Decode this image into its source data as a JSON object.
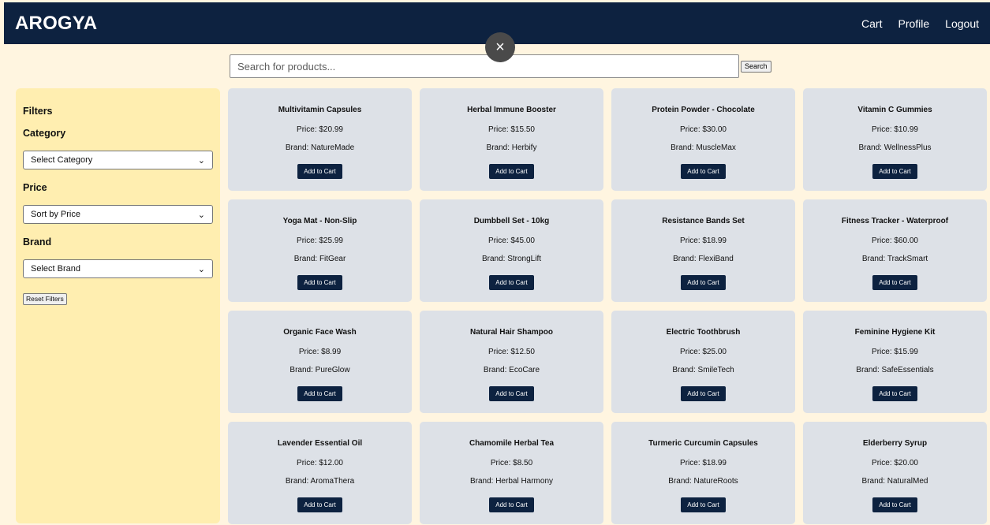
{
  "header": {
    "logo": "AROGYA",
    "links": [
      "Cart",
      "Profile",
      "Logout"
    ]
  },
  "overlay": {
    "close_glyph": "×",
    "close_icon": "close-icon"
  },
  "search": {
    "placeholder": "Search for products...",
    "value": "",
    "button_label": "Search"
  },
  "sidebar": {
    "title": "Filters",
    "category_label": "Category",
    "category_select": "Select Category",
    "price_label": "Price",
    "price_select": "Sort by Price",
    "brand_label": "Brand",
    "brand_select": "Select Brand",
    "reset_label": "Reset Filters",
    "chevron": "⌄"
  },
  "products": [
    {
      "name": "Multivitamin Capsules",
      "price": "Price: $20.99",
      "brand": "Brand: NatureMade"
    },
    {
      "name": "Herbal Immune Booster",
      "price": "Price: $15.50",
      "brand": "Brand: Herbify"
    },
    {
      "name": "Protein Powder - Chocolate",
      "price": "Price: $30.00",
      "brand": "Brand: MuscleMax"
    },
    {
      "name": "Vitamin C Gummies",
      "price": "Price: $10.99",
      "brand": "Brand: WellnessPlus"
    },
    {
      "name": "Yoga Mat - Non-Slip",
      "price": "Price: $25.99",
      "brand": "Brand: FitGear"
    },
    {
      "name": "Dumbbell Set - 10kg",
      "price": "Price: $45.00",
      "brand": "Brand: StrongLift"
    },
    {
      "name": "Resistance Bands Set",
      "price": "Price: $18.99",
      "brand": "Brand: FlexiBand"
    },
    {
      "name": "Fitness Tracker - Waterproof",
      "price": "Price: $60.00",
      "brand": "Brand: TrackSmart"
    },
    {
      "name": "Organic Face Wash",
      "price": "Price: $8.99",
      "brand": "Brand: PureGlow"
    },
    {
      "name": "Natural Hair Shampoo",
      "price": "Price: $12.50",
      "brand": "Brand: EcoCare"
    },
    {
      "name": "Electric Toothbrush",
      "price": "Price: $25.00",
      "brand": "Brand: SmileTech"
    },
    {
      "name": "Feminine Hygiene Kit",
      "price": "Price: $15.99",
      "brand": "Brand: SafeEssentials"
    },
    {
      "name": "Lavender Essential Oil",
      "price": "Price: $12.00",
      "brand": "Brand: AromaThera"
    },
    {
      "name": "Chamomile Herbal Tea",
      "price": "Price: $8.50",
      "brand": "Brand: Herbal Harmony"
    },
    {
      "name": "Turmeric Curcumin Capsules",
      "price": "Price: $18.99",
      "brand": "Brand: NatureRoots"
    },
    {
      "name": "Elderberry Syrup",
      "price": "Price: $20.00",
      "brand": "Brand: NaturalMed"
    }
  ],
  "add_to_cart_label": "Add to Cart",
  "colors": {
    "navbar": "#0d2240",
    "page_bg": "#fff5e0",
    "sidebar_bg": "#ffeeb0",
    "card_bg": "#dde1e7",
    "button_bg": "#0d2240"
  }
}
